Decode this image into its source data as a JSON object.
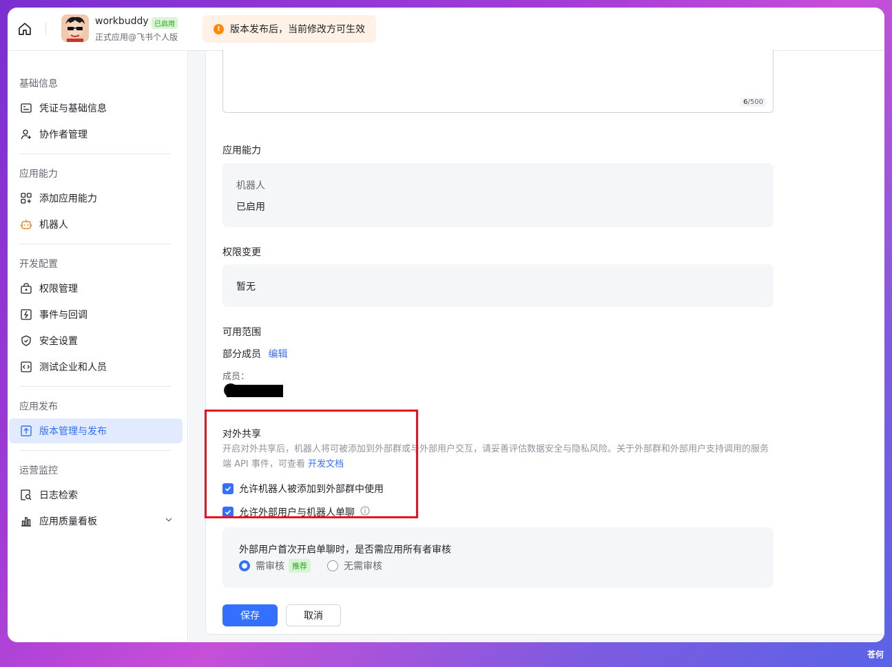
{
  "header": {
    "app_name": "workbuddy",
    "app_status": "已启用",
    "app_sub": "正式应用@飞书个人版",
    "notice": "版本发布后，当前修改方可生效"
  },
  "sidebar": {
    "sections": [
      {
        "title": "基础信息",
        "items": [
          {
            "label": "凭证与基础信息",
            "icon": "id-card-icon"
          },
          {
            "label": "协作者管理",
            "icon": "user-add-icon"
          }
        ]
      },
      {
        "title": "应用能力",
        "items": [
          {
            "label": "添加应用能力",
            "icon": "apps-add-icon"
          },
          {
            "label": "机器人",
            "icon": "robot-icon"
          }
        ]
      },
      {
        "title": "开发配置",
        "items": [
          {
            "label": "权限管理",
            "icon": "lock-box-icon"
          },
          {
            "label": "事件与回调",
            "icon": "event-icon"
          },
          {
            "label": "安全设置",
            "icon": "shield-icon"
          },
          {
            "label": "测试企业和人员",
            "icon": "code-icon"
          }
        ]
      },
      {
        "title": "应用发布",
        "items": [
          {
            "label": "版本管理与发布",
            "icon": "upload-icon",
            "active": true
          }
        ]
      },
      {
        "title": "运营监控",
        "items": [
          {
            "label": "日志检索",
            "icon": "log-search-icon"
          },
          {
            "label": "应用质量看板",
            "icon": "bar-chart-icon"
          }
        ]
      }
    ]
  },
  "main": {
    "textarea_counter_value": "6",
    "textarea_counter_max": "/500",
    "capability": {
      "label": "应用能力",
      "name": "机器人",
      "status": "已启用"
    },
    "permission": {
      "label": "权限变更",
      "value": "暂无"
    },
    "scope": {
      "label": "可用范围",
      "value": "部分成员",
      "edit": "编辑",
      "members_label": "成员："
    },
    "share": {
      "label": "对外共享",
      "desc": "开启对外共享后，机器人将可被添加到外部群或与外部用户交互，请妥善评估数据安全与隐私风险。关于外部群和外部用户支持调用的服务端 API 事件，可查看",
      "doc_link": "开发文档",
      "option1": "允许机器人被添加到外部群中使用",
      "option2": "允许外部用户与机器人单聊"
    },
    "review": {
      "question": "外部用户首次开启单聊时，是否需应用所有者审核",
      "opt_review": "需审核",
      "recommend": "推荐",
      "opt_no_review": "无需审核",
      "selected": "需审核"
    },
    "buttons": {
      "save": "保存",
      "cancel": "取消"
    }
  },
  "watermark": "苍何",
  "colors": {
    "accent": "#3370ff",
    "highlight": "#e8111d",
    "notice_bg": "#fff1e5"
  }
}
